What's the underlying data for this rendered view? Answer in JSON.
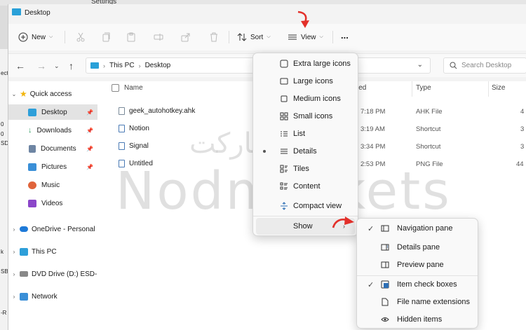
{
  "background": {
    "settings_title": "Settings",
    "left_fragments": [
      "ecti",
      "0",
      "0",
      "SD",
      "k",
      "SB",
      "-R"
    ]
  },
  "window": {
    "title": "Desktop"
  },
  "toolbar": {
    "new_label": "New",
    "sort_label": "Sort",
    "view_label": "View",
    "more_label": "..."
  },
  "address": {
    "crumbs": [
      "This PC",
      "Desktop"
    ],
    "search_placeholder": "Search Desktop"
  },
  "sidebar": {
    "items": [
      {
        "label": "Quick access",
        "icon": "star-icon",
        "color": "#f2b50a"
      },
      {
        "label": "Desktop",
        "icon": "desktop-folder-icon",
        "color": "#2e9fd9"
      },
      {
        "label": "Downloads",
        "icon": "downloads-icon",
        "color": "#2f9c61"
      },
      {
        "label": "Documents",
        "icon": "documents-icon",
        "color": "#6e85a3"
      },
      {
        "label": "Pictures",
        "icon": "pictures-icon",
        "color": "#3a8fd7"
      },
      {
        "label": "Music",
        "icon": "music-icon",
        "color": "#e0643b"
      },
      {
        "label": "Videos",
        "icon": "videos-icon",
        "color": "#8b46c9"
      },
      {
        "label": "OneDrive - Personal",
        "icon": "onedrive-icon",
        "color": "#1e7ad8"
      },
      {
        "label": "This PC",
        "icon": "this-pc-icon",
        "color": "#2e9fd9"
      },
      {
        "label": "DVD Drive (D:) ESD-",
        "icon": "dvd-drive-icon",
        "color": "#888888"
      },
      {
        "label": "Network",
        "icon": "network-icon",
        "color": "#3a8fd7"
      }
    ]
  },
  "files": {
    "columns": {
      "name": "Name",
      "date": "ied",
      "type": "Type",
      "size": "Size"
    },
    "rows": [
      {
        "name": "geek_autohotkey.ahk",
        "date": "7:18 PM",
        "type": "AHK File",
        "size": "4"
      },
      {
        "name": "Notion",
        "date": "3:19 AM",
        "type": "Shortcut",
        "size": "3"
      },
      {
        "name": "Signal",
        "date": "3:34 PM",
        "type": "Shortcut",
        "size": "3"
      },
      {
        "name": "Untitled",
        "date": "2:53 PM",
        "type": "PNG File",
        "size": "44"
      }
    ]
  },
  "view_menu": {
    "items": [
      "Extra large icons",
      "Large icons",
      "Medium icons",
      "Small icons",
      "List",
      "Details",
      "Tiles",
      "Content",
      "Compact view",
      "Show"
    ],
    "selected": "Details"
  },
  "show_menu": {
    "items": [
      {
        "label": "Navigation pane",
        "checked": true
      },
      {
        "label": "Details pane",
        "checked": false
      },
      {
        "label": "Preview pane",
        "checked": false
      },
      {
        "label": "Item check boxes",
        "checked": true
      },
      {
        "label": "File name extensions",
        "checked": false
      },
      {
        "label": "Hidden items",
        "checked": false
      }
    ]
  },
  "watermark": {
    "latin": "Nodmarkets",
    "arabic": "نادمارکت"
  },
  "colors": {
    "accent": "#2e9fd9",
    "arrow": "#e3302a"
  }
}
